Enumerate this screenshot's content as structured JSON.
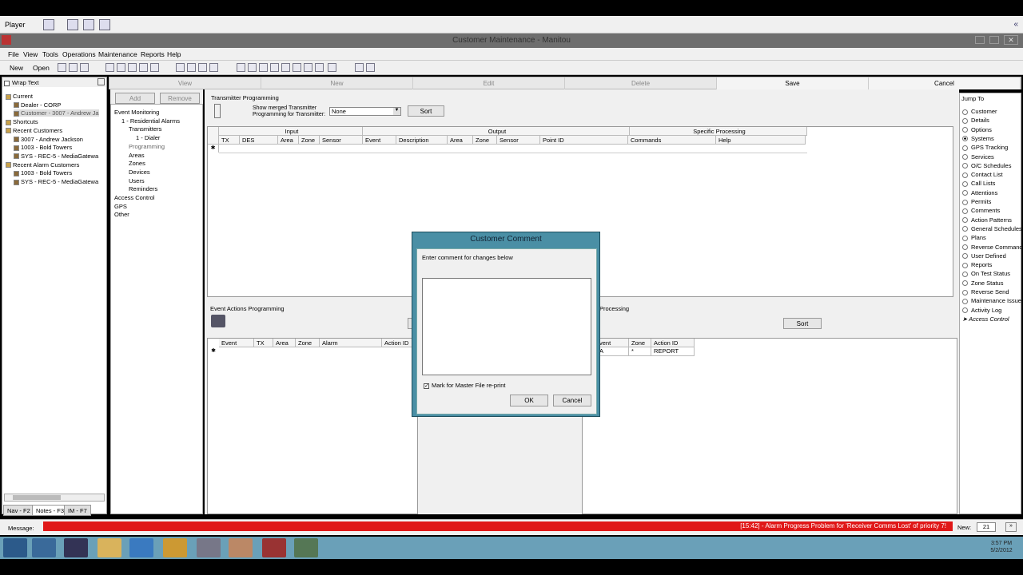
{
  "player": {
    "label": "Player"
  },
  "window": {
    "title": "Customer Maintenance - Manitou"
  },
  "menu": [
    "File",
    "View",
    "Tools",
    "Operations",
    "Maintenance",
    "Reports",
    "Help"
  ],
  "toolbar": {
    "new_label": "New",
    "open_label": "Open"
  },
  "left": {
    "wrap_text": "Wrap Text",
    "tree": [
      {
        "label": "Current",
        "indent": 0,
        "icon": "folder-icon"
      },
      {
        "label": "Dealer - CORP",
        "indent": 1,
        "icon": "dealer-icon"
      },
      {
        "label": "Customer - 3007 - Andrew Ja",
        "indent": 1,
        "icon": "customer-icon",
        "selected": true
      },
      {
        "label": "Shortcuts",
        "indent": 0,
        "icon": "folder-icon"
      },
      {
        "label": "Recent Customers",
        "indent": 0,
        "icon": "folder-icon"
      },
      {
        "label": "3007 - Andrew Jackson",
        "indent": 1,
        "icon": "customer-icon"
      },
      {
        "label": "1003 - Bold Towers",
        "indent": 1,
        "icon": "customer-icon"
      },
      {
        "label": "SYS - REC-5 - MediaGatewa",
        "indent": 1,
        "icon": "customer-icon"
      },
      {
        "label": "Recent Alarm Customers",
        "indent": 0,
        "icon": "folder-icon"
      },
      {
        "label": "1003 - Bold Towers",
        "indent": 1,
        "icon": "customer-icon"
      },
      {
        "label": "SYS - REC-5 - MediaGatewa",
        "indent": 1,
        "icon": "customer-icon"
      }
    ],
    "tabs": [
      "Nav - F2",
      "Notes - F3",
      "IM - F7"
    ]
  },
  "actions": [
    "View",
    "New",
    "Edit",
    "Delete",
    "Save",
    "Cancel"
  ],
  "addrem": {
    "add": "Add",
    "remove": "Remove"
  },
  "midtree": [
    {
      "label": "Event Monitoring",
      "indent": 0
    },
    {
      "label": "1 - Residential Alarms",
      "indent": 1
    },
    {
      "label": "Transmitters",
      "indent": 2
    },
    {
      "label": "1 - Dialer",
      "indent": 3
    },
    {
      "label": "Programming",
      "indent": 2
    },
    {
      "label": "Areas",
      "indent": 2
    },
    {
      "label": "Zones",
      "indent": 2
    },
    {
      "label": "Devices",
      "indent": 2
    },
    {
      "label": "Users",
      "indent": 2
    },
    {
      "label": "Reminders",
      "indent": 2
    },
    {
      "label": "Access Control",
      "indent": 0
    },
    {
      "label": "GPS",
      "indent": 0
    },
    {
      "label": "Other",
      "indent": 0
    }
  ],
  "tx": {
    "section": "Transmitter Programming",
    "show_merged": "Show merged Transmitter Programming for Transmitter:",
    "select_value": "None",
    "sort": "Sort",
    "groups": [
      "Input",
      "Output",
      "Specific Processing"
    ],
    "cols": [
      "TX",
      "DES",
      "Area",
      "Zone",
      "Sensor",
      "Event",
      "Description",
      "Area",
      "Zone",
      "Sensor",
      "Point ID",
      "Commands",
      "Help"
    ]
  },
  "ev": {
    "section": "Event Actions Programming",
    "cols": [
      "Event",
      "TX",
      "Area",
      "Zone",
      "Alarm",
      "Action ID"
    ],
    "right_section": "Processing",
    "sort": "Sort",
    "right_cols": [
      "vent",
      "Zone",
      "Action ID"
    ],
    "right_row": [
      "A",
      "*",
      "REPORT"
    ]
  },
  "jump": {
    "title": "Jump To",
    "items": [
      "Customer",
      "Details",
      "Options",
      "Systems",
      "GPS Tracking",
      "Services",
      "O/C Schedules",
      "Contact List",
      "Call Lists",
      "Attentions",
      "Permits",
      "Comments",
      "Action Patterns",
      "General Schedules",
      "Plans",
      "Reverse Command",
      "User Defined",
      "Reports",
      "On Test Status",
      "Zone Status",
      "Reverse Send",
      "Maintenance Issue",
      "Activity Log",
      "Access Control"
    ],
    "selected": "Systems"
  },
  "status": {
    "message_label": "Message:",
    "alarm": "[15:42] - Alarm Progress Problem for 'Receiver Comms Lost' of priority 7!",
    "new_label": "New:",
    "new_count": "21"
  },
  "dialog": {
    "title": "Customer Comment",
    "prompt": "Enter comment for changes below",
    "comment": "",
    "checkbox": "Mark for Master File re-print",
    "ok": "OK",
    "cancel": "Cancel"
  },
  "clock": {
    "time": "3:57 PM",
    "date": "5/2/2012"
  }
}
